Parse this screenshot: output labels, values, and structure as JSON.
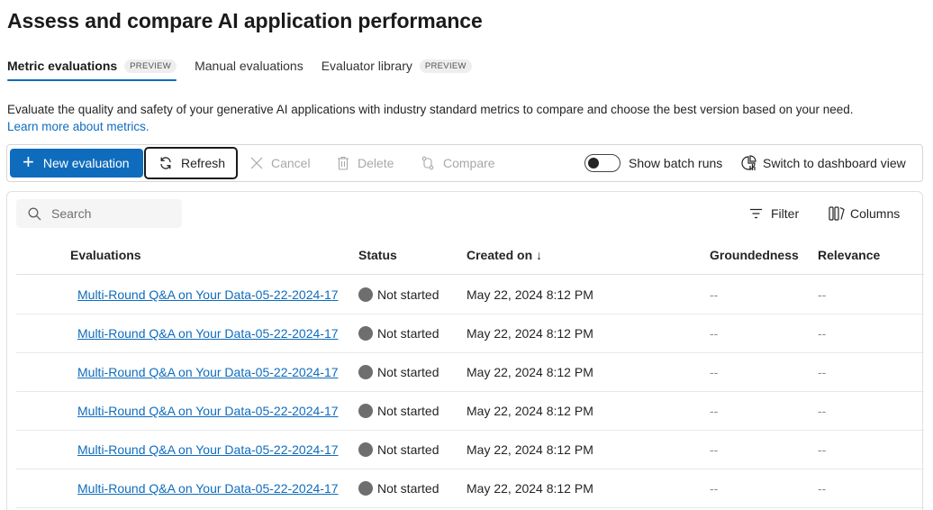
{
  "page": {
    "title": "Assess and compare AI application performance"
  },
  "tabs": [
    {
      "label": "Metric evaluations",
      "badge": "PREVIEW",
      "active": true
    },
    {
      "label": "Manual evaluations",
      "badge": "",
      "active": false
    },
    {
      "label": "Evaluator library",
      "badge": "PREVIEW",
      "active": false
    }
  ],
  "description": {
    "text": "Evaluate the quality and safety of your generative AI applications with industry standard metrics to compare and choose the best version based on your need.",
    "link": "Learn more about metrics."
  },
  "toolbar": {
    "new_evaluation": "New evaluation",
    "refresh": "Refresh",
    "cancel": "Cancel",
    "delete": "Delete",
    "compare": "Compare",
    "show_batch_runs": "Show batch runs",
    "switch_view": "Switch to dashboard view"
  },
  "grid": {
    "search_placeholder": "Search",
    "filter": "Filter",
    "columns_btn": "Columns",
    "headers": {
      "evaluations": "Evaluations",
      "status": "Status",
      "created_on": "Created on",
      "sort_arrow": "↓",
      "groundedness": "Groundedness",
      "relevance": "Relevance"
    },
    "rows": [
      {
        "name": "Multi-Round Q&A on Your Data-05-22-2024-17",
        "status": "Not started",
        "created": "May 22, 2024 8:12 PM",
        "groundedness": "--",
        "relevance": "--"
      },
      {
        "name": "Multi-Round Q&A on Your Data-05-22-2024-17",
        "status": "Not started",
        "created": "May 22, 2024 8:12 PM",
        "groundedness": "--",
        "relevance": "--"
      },
      {
        "name": "Multi-Round Q&A on Your Data-05-22-2024-17",
        "status": "Not started",
        "created": "May 22, 2024 8:12 PM",
        "groundedness": "--",
        "relevance": "--"
      },
      {
        "name": "Multi-Round Q&A on Your Data-05-22-2024-17",
        "status": "Not started",
        "created": "May 22, 2024 8:12 PM",
        "groundedness": "--",
        "relevance": "--"
      },
      {
        "name": "Multi-Round Q&A on Your Data-05-22-2024-17",
        "status": "Not started",
        "created": "May 22, 2024 8:12 PM",
        "groundedness": "--",
        "relevance": "--"
      },
      {
        "name": "Multi-Round Q&A on Your Data-05-22-2024-17",
        "status": "Not started",
        "created": "May 22, 2024 8:12 PM",
        "groundedness": "--",
        "relevance": "--"
      }
    ]
  },
  "colors": {
    "accent": "#0f6cbd",
    "status_dot": "#6e6e6e",
    "disabled": "#a8a8a8"
  },
  "icons": [
    "plus-icon",
    "refresh-icon",
    "close-icon",
    "trash-icon",
    "compare-icon",
    "dashboard-icon",
    "search-icon",
    "filter-icon",
    "columns-icon",
    "status-dot-icon"
  ]
}
